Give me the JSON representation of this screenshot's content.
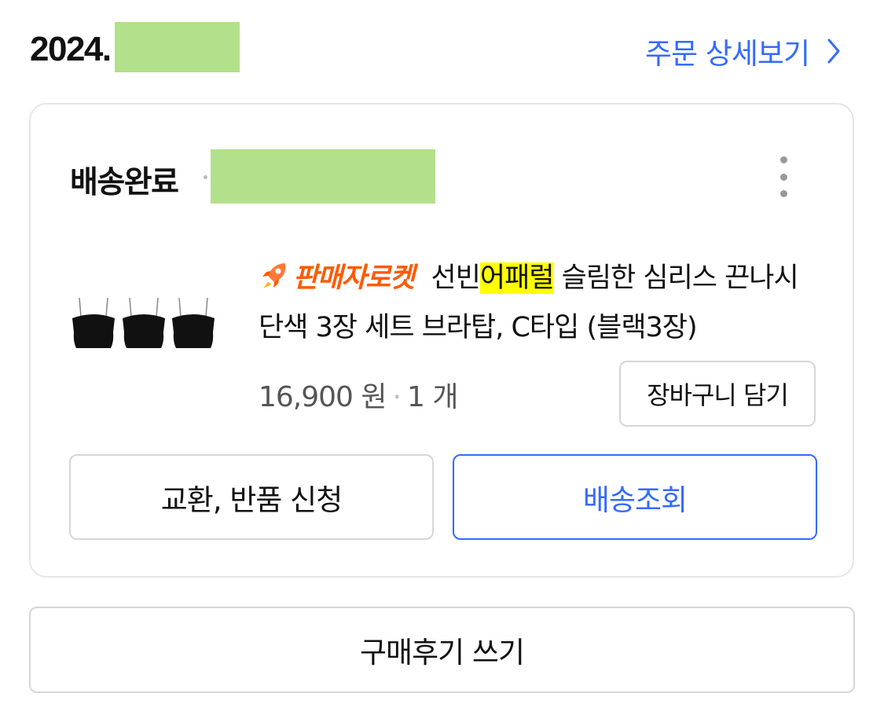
{
  "order": {
    "date_prefix": "2024.",
    "detail_link_label": "주문 상세보기"
  },
  "card": {
    "status": "배송완료",
    "product": {
      "badge": "판매자로켓",
      "title_before": "선빈",
      "title_highlight": "어패럴",
      "title_after": " 슬림한 심리스 끈나시 단색 3장 세트 브라탑, C타입 (블랙3장)",
      "price": "16,900 원",
      "quantity": "1 개"
    },
    "cart_button": "장바구니 담기",
    "exchange_button": "교환, 반품 신청",
    "track_button": "배송조회"
  },
  "review_button": "구매후기 쓰기",
  "icons": {
    "detail_chevron": "chevron-right-icon",
    "more": "more-vertical-icon",
    "badge": "rocket-icon"
  },
  "colors": {
    "accent_blue": "#346aff",
    "rocket_orange": "#ff5a00",
    "highlight": "#ffff00",
    "redaction": "#b3e08a"
  }
}
